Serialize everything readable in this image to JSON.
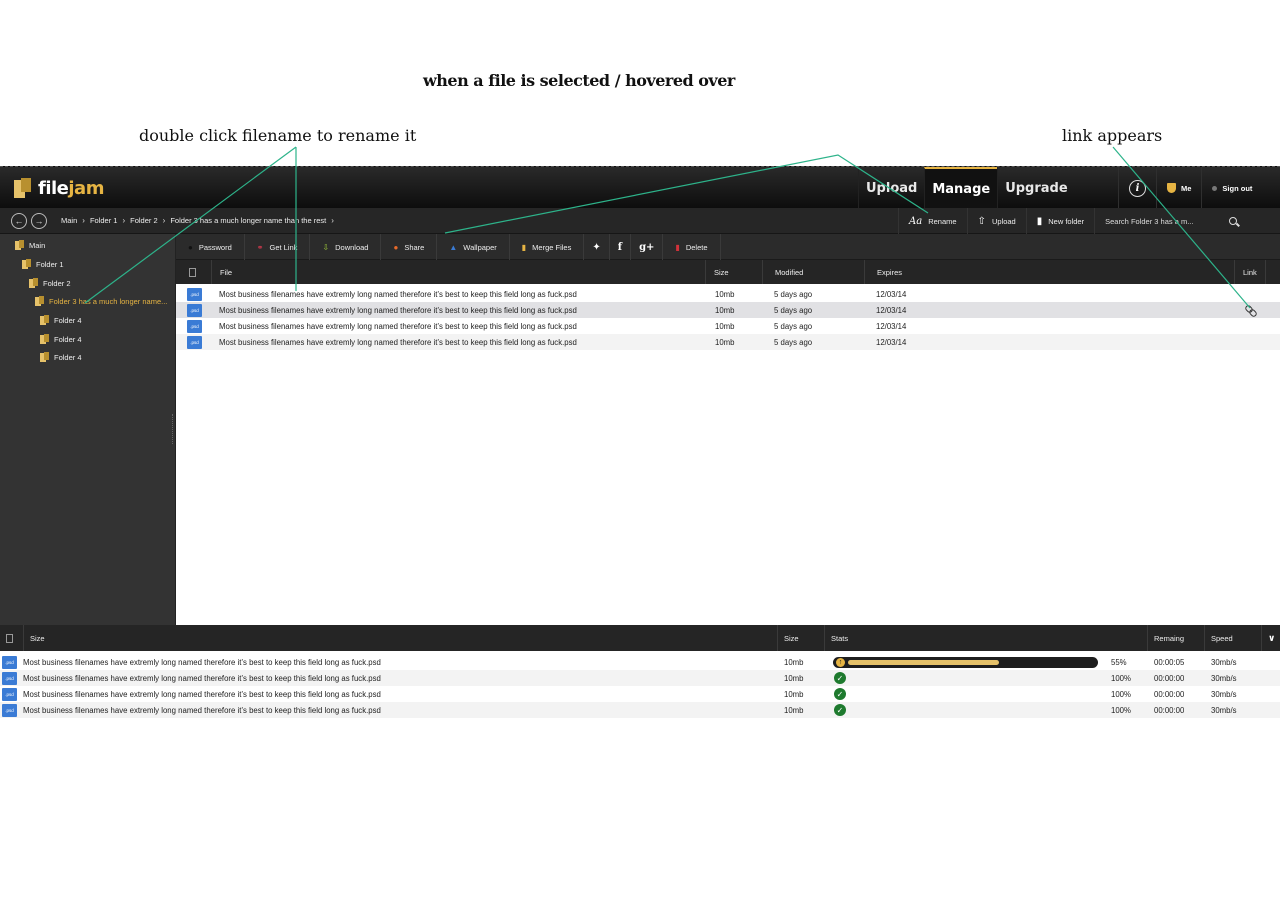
{
  "annotations": {
    "selected": "when a file is selected / hovered over",
    "rename": "double click filename to rename it",
    "link": "link appears"
  },
  "app": {
    "logo_main": "file",
    "logo_accent": "jam",
    "nav": [
      "Upload",
      "Manage",
      "Upgrade"
    ],
    "me_label": "Me",
    "signout_label": "Sign out"
  },
  "breadcrumb": [
    "Main",
    "Folder 1",
    "Folder 2",
    "Folder 3 has a much longer name than the rest"
  ],
  "crumb_actions": {
    "rename": "Rename",
    "upload": "Upload",
    "new_folder": "New folder",
    "search_placeholder": "Search Folder 3 has a m..."
  },
  "sidebar": {
    "items": [
      "Main",
      "Folder 1",
      "Folder 2",
      "Folder 3 has a much longer name...",
      "Folder 4",
      "Folder 4",
      "Folder 4"
    ]
  },
  "toolbar": {
    "password": "Password",
    "get_link": "Get Link",
    "download": "Download",
    "share": "Share",
    "wallpaper": "Wallpaper",
    "merge": "Merge Files",
    "delete": "Delete"
  },
  "files": {
    "headers": {
      "file": "File",
      "size": "Size",
      "modified": "Modified",
      "expires": "Expires",
      "link": "Link"
    },
    "rows": [
      {
        "icon": ".psd",
        "name": "Most business filenames have extremly long named therefore it’s best to keep this field long as fuck.psd",
        "size": "10mb",
        "modified": "5 days ago",
        "expires": "12/03/14"
      },
      {
        "icon": ".psd",
        "name": "Most business filenames have extremly long named therefore it’s best to keep this field long as fuck.psd",
        "size": "10mb",
        "modified": "5 days ago",
        "expires": "12/03/14"
      },
      {
        "icon": ".psd",
        "name": "Most business filenames have extremly long named therefore it’s best to keep this field long as fuck.psd",
        "size": "10mb",
        "modified": "5 days ago",
        "expires": "12/03/14"
      },
      {
        "icon": ".psd",
        "name": "Most business filenames have extremly long named therefore it’s best to keep this field long as fuck.psd",
        "size": "10mb",
        "modified": "5 days ago",
        "expires": "12/03/14"
      }
    ]
  },
  "queue": {
    "headers": {
      "name": "Size",
      "size": "Size",
      "stats": "Stats",
      "remaining": "Remaing",
      "speed": "Speed"
    },
    "rows": [
      {
        "icon": ".psd",
        "name": "Most business filenames have extremly long named therefore it’s best to keep this field long as fuck.psd",
        "size": "10mb",
        "progress": 0.55,
        "percent": "55%",
        "remaining": "00:00:05",
        "speed": "30mb/s"
      },
      {
        "icon": ".psd",
        "name": "Most business filenames have extremly long named therefore it’s best to keep this field long as fuck.psd",
        "size": "10mb",
        "progress": 1.0,
        "percent": "100%",
        "remaining": "00:00:00",
        "speed": "30mb/s"
      },
      {
        "icon": ".psd",
        "name": "Most business filenames have extremly long named therefore it’s best to keep this field long as fuck.psd",
        "size": "10mb",
        "progress": 1.0,
        "percent": "100%",
        "remaining": "00:00:00",
        "speed": "30mb/s"
      },
      {
        "icon": ".psd",
        "name": "Most business filenames have extremly long named therefore it’s best to keep this field long as fuck.psd",
        "size": "10mb",
        "progress": 1.0,
        "percent": "100%",
        "remaining": "00:00:00",
        "speed": "30mb/s"
      }
    ]
  },
  "colors": {
    "accent": "#e6b443",
    "psd_icon": "#3a7bd5",
    "complete": "#1e7a2e",
    "annotation_line": "#2db38a"
  }
}
